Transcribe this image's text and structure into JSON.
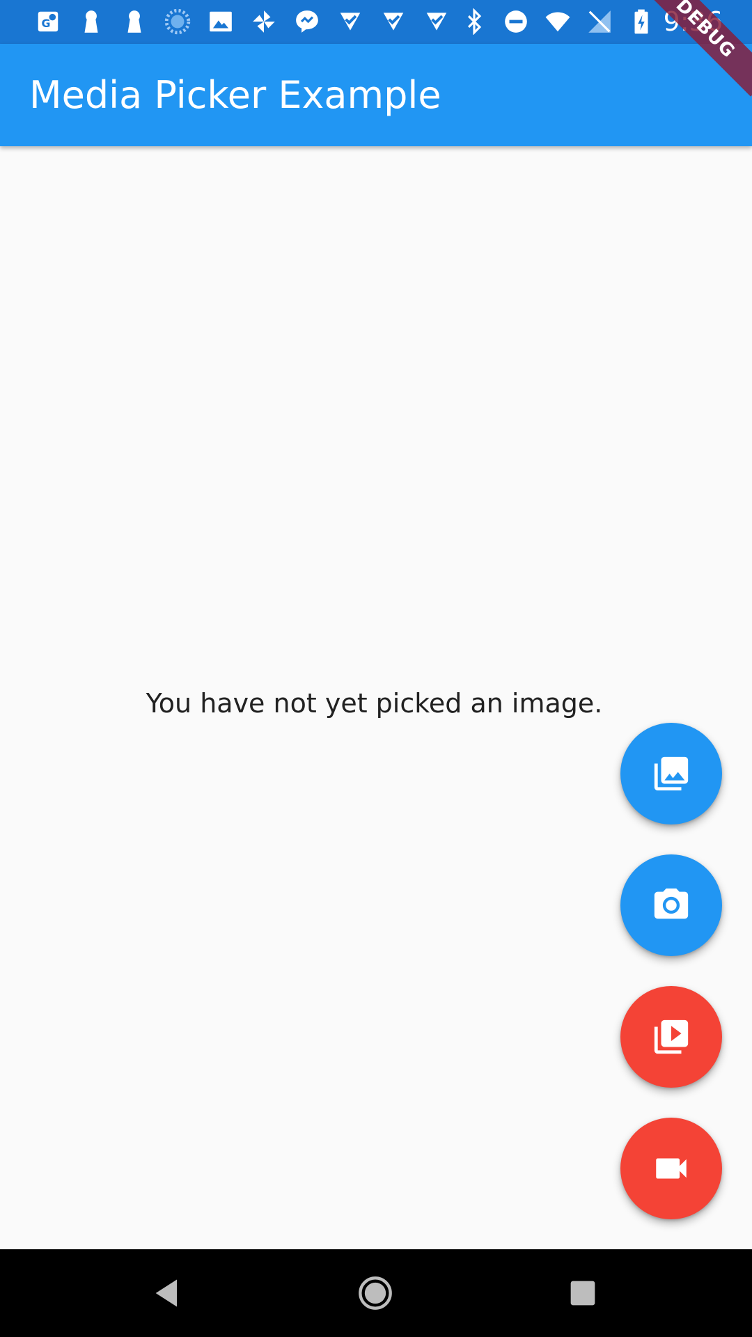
{
  "status_bar": {
    "time": "9:36",
    "left_icons": [
      "maps-icon",
      "keyhole-icon",
      "keyhole-icon",
      "loading-icon",
      "image-icon",
      "pinwheel-icon",
      "messenger-icon",
      "check-icon",
      "check-icon",
      "check-icon"
    ],
    "right_icons": [
      "bluetooth-icon",
      "do-not-disturb-icon",
      "wifi-icon",
      "no-sim-icon",
      "battery-charging-icon"
    ]
  },
  "debug_banner": {
    "label": "DEBUG"
  },
  "app_bar": {
    "title": "Media Picker Example"
  },
  "main": {
    "message": "You have not yet picked an image."
  },
  "fabs": [
    {
      "icon": "photo-library-icon",
      "color": "#2196f3"
    },
    {
      "icon": "camera-icon",
      "color": "#2196f3"
    },
    {
      "icon": "video-library-icon",
      "color": "#f44336"
    },
    {
      "icon": "videocam-icon",
      "color": "#f44336"
    }
  ],
  "nav_bar": {
    "buttons": [
      "back-icon",
      "home-icon",
      "recents-icon"
    ]
  },
  "colors": {
    "status_bar": "#1976d2",
    "app_bar": "#2196f3",
    "background": "#fafafa",
    "fab_blue": "#2196f3",
    "fab_red": "#f44336",
    "nav_bar": "#000000"
  }
}
